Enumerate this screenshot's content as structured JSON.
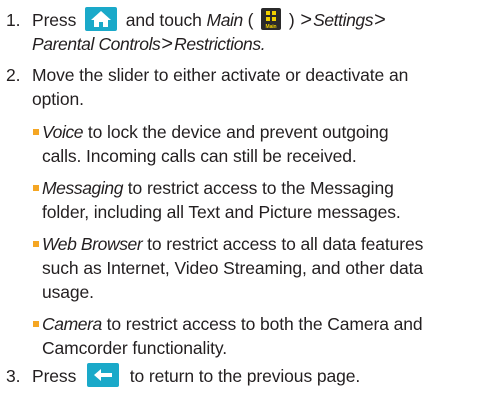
{
  "steps": [
    {
      "number": "1.",
      "text_press": "Press",
      "home_icon": "home-icon",
      "text_touch": "and touch",
      "main_label": "Main",
      "open_paren": "(",
      "main_icon": "main-menu-icon",
      "main_icon_label": "Main",
      "close_paren": ")",
      "path_sep": ">",
      "path_settings": "Settings",
      "path_parental": "Parental Controls",
      "path_restrictions": "Restrictions",
      "end": "."
    },
    {
      "number": "2.",
      "line1": "Move the slider to either activate or deactivate an",
      "line2": "option."
    },
    {
      "number": "3.",
      "text_press": "Press",
      "back_icon": "back-icon",
      "text_after": "to return to the previous page."
    }
  ],
  "bullets": [
    {
      "term": "Voice",
      "line1_rest": " to lock the device and prevent outgoing",
      "more_lines": [
        "calls. Incoming calls can still be received."
      ]
    },
    {
      "term": "Messaging",
      "line1_rest": " to restrict access to the Messaging",
      "more_lines": [
        "folder, including all Text and Picture messages."
      ]
    },
    {
      "term": "Web Browser",
      "line1_rest": " to restrict access to all data features",
      "more_lines": [
        "such as Internet, Video Streaming, and other data",
        "usage."
      ]
    },
    {
      "term": "Camera",
      "line1_rest": " to restrict access to both the Camera and",
      "more_lines": [
        "Camcorder functionality."
      ]
    }
  ],
  "colors": {
    "icon_blue": "#1aa9c9",
    "bullet_orange": "#f5a623",
    "main_icon_yellow": "#f0d000"
  }
}
